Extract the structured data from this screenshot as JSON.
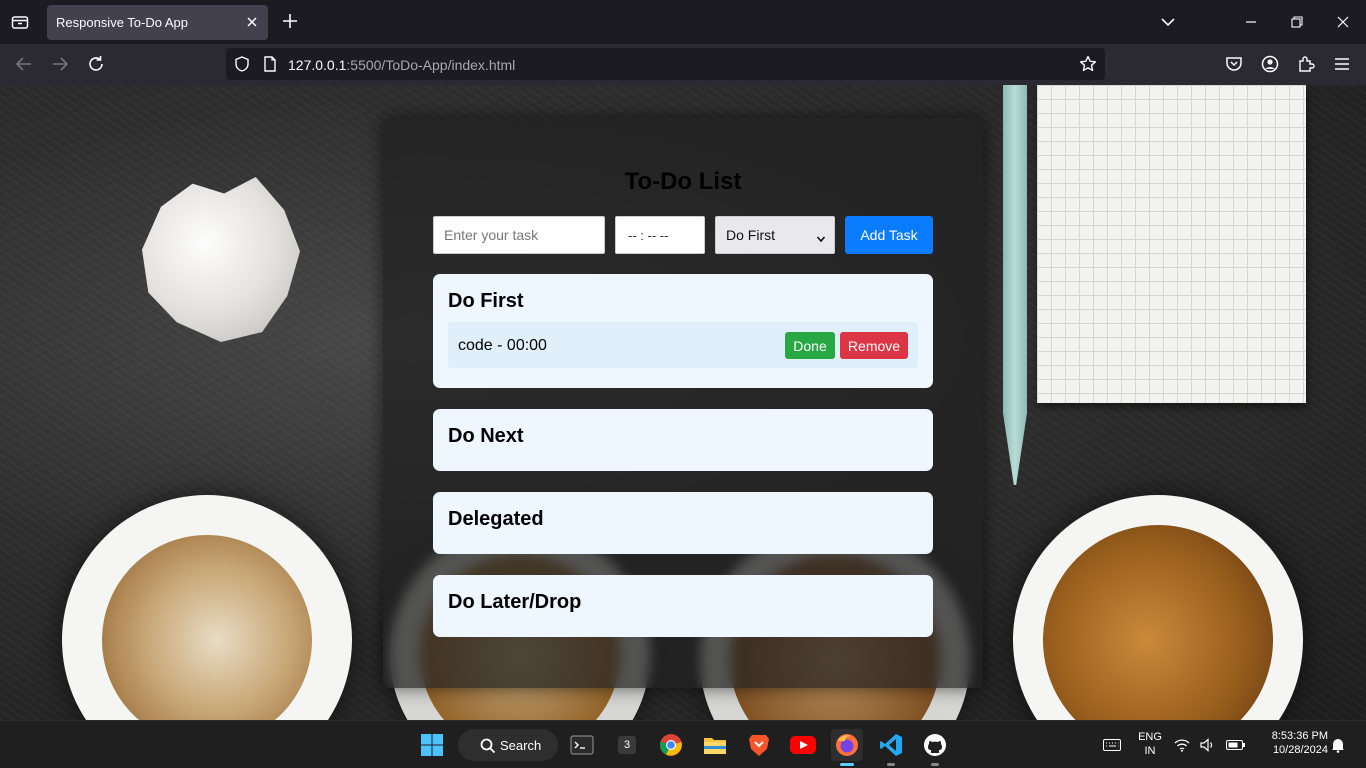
{
  "browser": {
    "tab_title": "Responsive To-Do App",
    "url_host": "127.0.0.1",
    "url_path": ":5500/ToDo-App/index.html"
  },
  "app": {
    "title": "To-Do List",
    "task_placeholder": "Enter your task",
    "time_value": "-- : --  --",
    "priority_selected": "Do First",
    "add_button": "Add Task",
    "quadrants": [
      {
        "title": "Do First",
        "tasks": [
          {
            "text": "code - 00:00",
            "done_label": "Done",
            "remove_label": "Remove"
          }
        ]
      },
      {
        "title": "Do Next",
        "tasks": []
      },
      {
        "title": "Delegated",
        "tasks": []
      },
      {
        "title": "Do Later/Drop",
        "tasks": []
      }
    ]
  },
  "taskbar": {
    "search_label": "Search",
    "badge_count": "3",
    "lang_line1": "ENG",
    "lang_line2": "IN",
    "time": "8:53:36 PM",
    "date": "10/28/2024"
  },
  "icons": [
    "tab-list-icon",
    "close-icon",
    "plus-icon",
    "chevron-down-icon",
    "minimize-icon",
    "restore-icon",
    "back-icon",
    "forward-icon",
    "reload-icon",
    "shield-icon",
    "page-icon",
    "star-icon",
    "pocket-icon",
    "account-icon",
    "extensions-icon",
    "menu-icon",
    "windows-start-icon",
    "search-icon",
    "terminal-icon",
    "chrome-icon",
    "file-explorer-icon",
    "brave-icon",
    "youtube-icon",
    "firefox-icon",
    "vscode-icon",
    "github-icon",
    "keyboard-icon",
    "wifi-icon",
    "speaker-icon",
    "battery-icon",
    "notification-icon"
  ],
  "colors": {
    "accent_blue": "#0a7cff",
    "done_green": "#28a745",
    "remove_red": "#dc3545",
    "quadrant_bg": "#eef6ff"
  }
}
